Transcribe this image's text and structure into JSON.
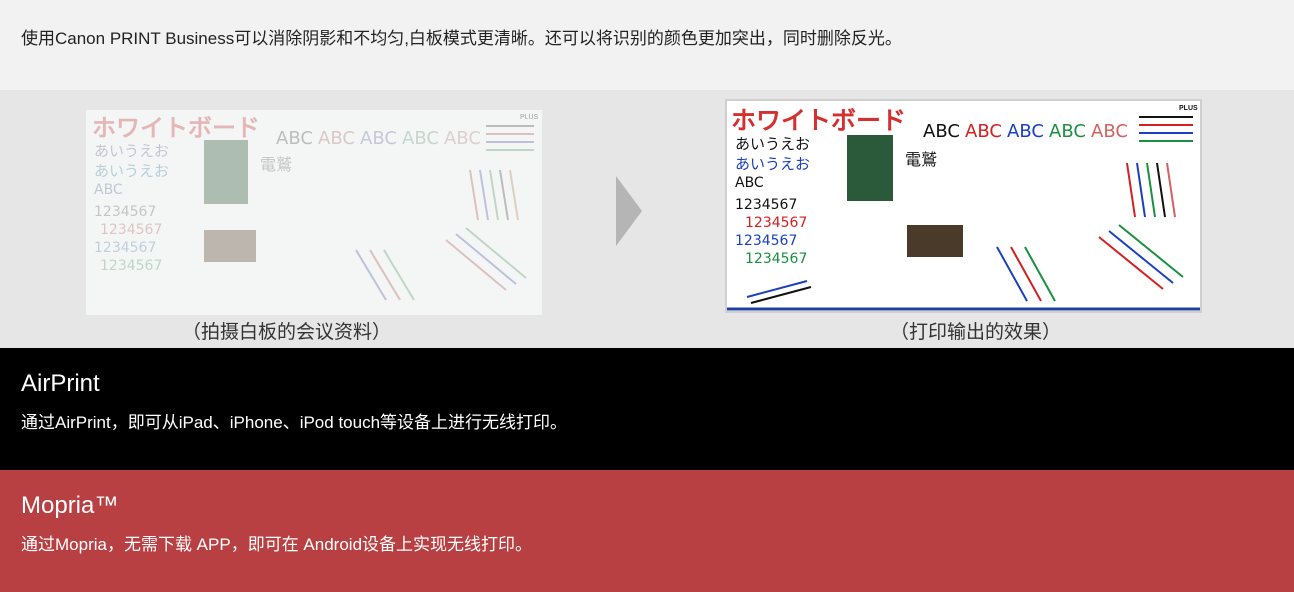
{
  "intro": {
    "text": "使用Canon PRINT Business可以消除阴影和不均匀,白板模式更清晰。还可以将识别的颜色更加突出，同时删除反光。"
  },
  "comparison": {
    "before_caption": "（拍摄白板的会议资料）",
    "after_caption": "（打印输出的效果）",
    "whiteboard": {
      "title": "ホワイトボード",
      "brand": "PLUS",
      "kana_line_1": "あいうえお",
      "kana_line_2": "あいうえお",
      "abc_line": "ABC",
      "digits": "1234567",
      "letters": [
        "ABC",
        "ABC",
        "ABC",
        "ABC",
        "ABC"
      ],
      "kanji": "電鷲"
    },
    "arrow_icon": "chevron-right-icon"
  },
  "airprint": {
    "title": "AirPrint",
    "description": "通过AirPrint，即可从iPad、iPhone、iPod touch等设备上进行无线打印。"
  },
  "mopria": {
    "title": "Mopria™",
    "description": "通过Mopria，无需下载 APP，即可在 Android设备上实现无线打印。"
  },
  "colors": {
    "intro_bg": "#f2f2f2",
    "compare_bg": "#e6e6e6",
    "airprint_bg": "#000000",
    "mopria_bg": "#b84043"
  }
}
